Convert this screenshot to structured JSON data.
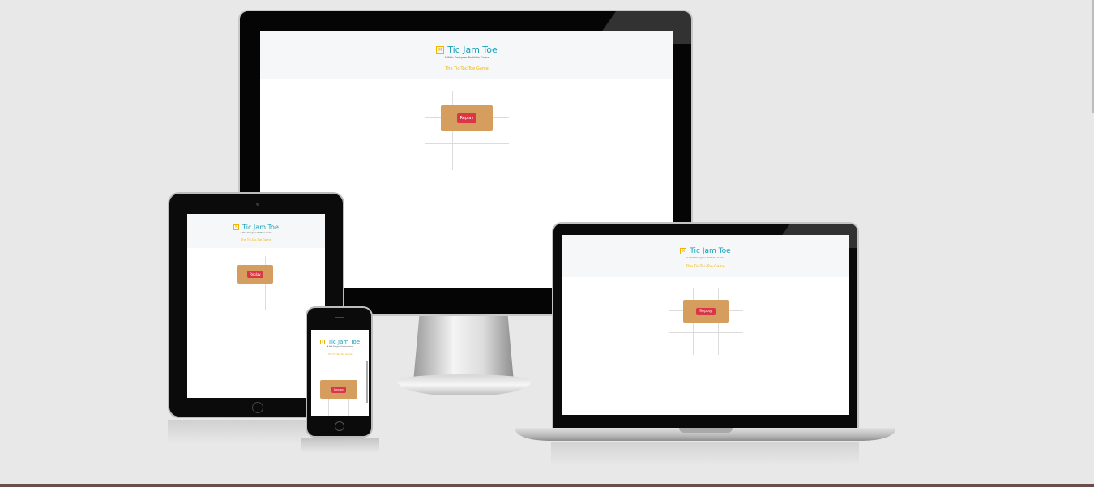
{
  "site": {
    "title": "Tic Jam Toe",
    "tagline": "A Web Designer Portfolio Game",
    "subtitle": "The Tic-Tac-Toe Game",
    "replay_label": "Replay",
    "icon": "x-box-icon"
  },
  "colors": {
    "title": "#17a2b8",
    "accent": "#f0b400",
    "modal": "#d59e5e",
    "replay_button": "#dc3545",
    "header_bg": "#f5f7f9",
    "background": "#e8e8e8"
  }
}
